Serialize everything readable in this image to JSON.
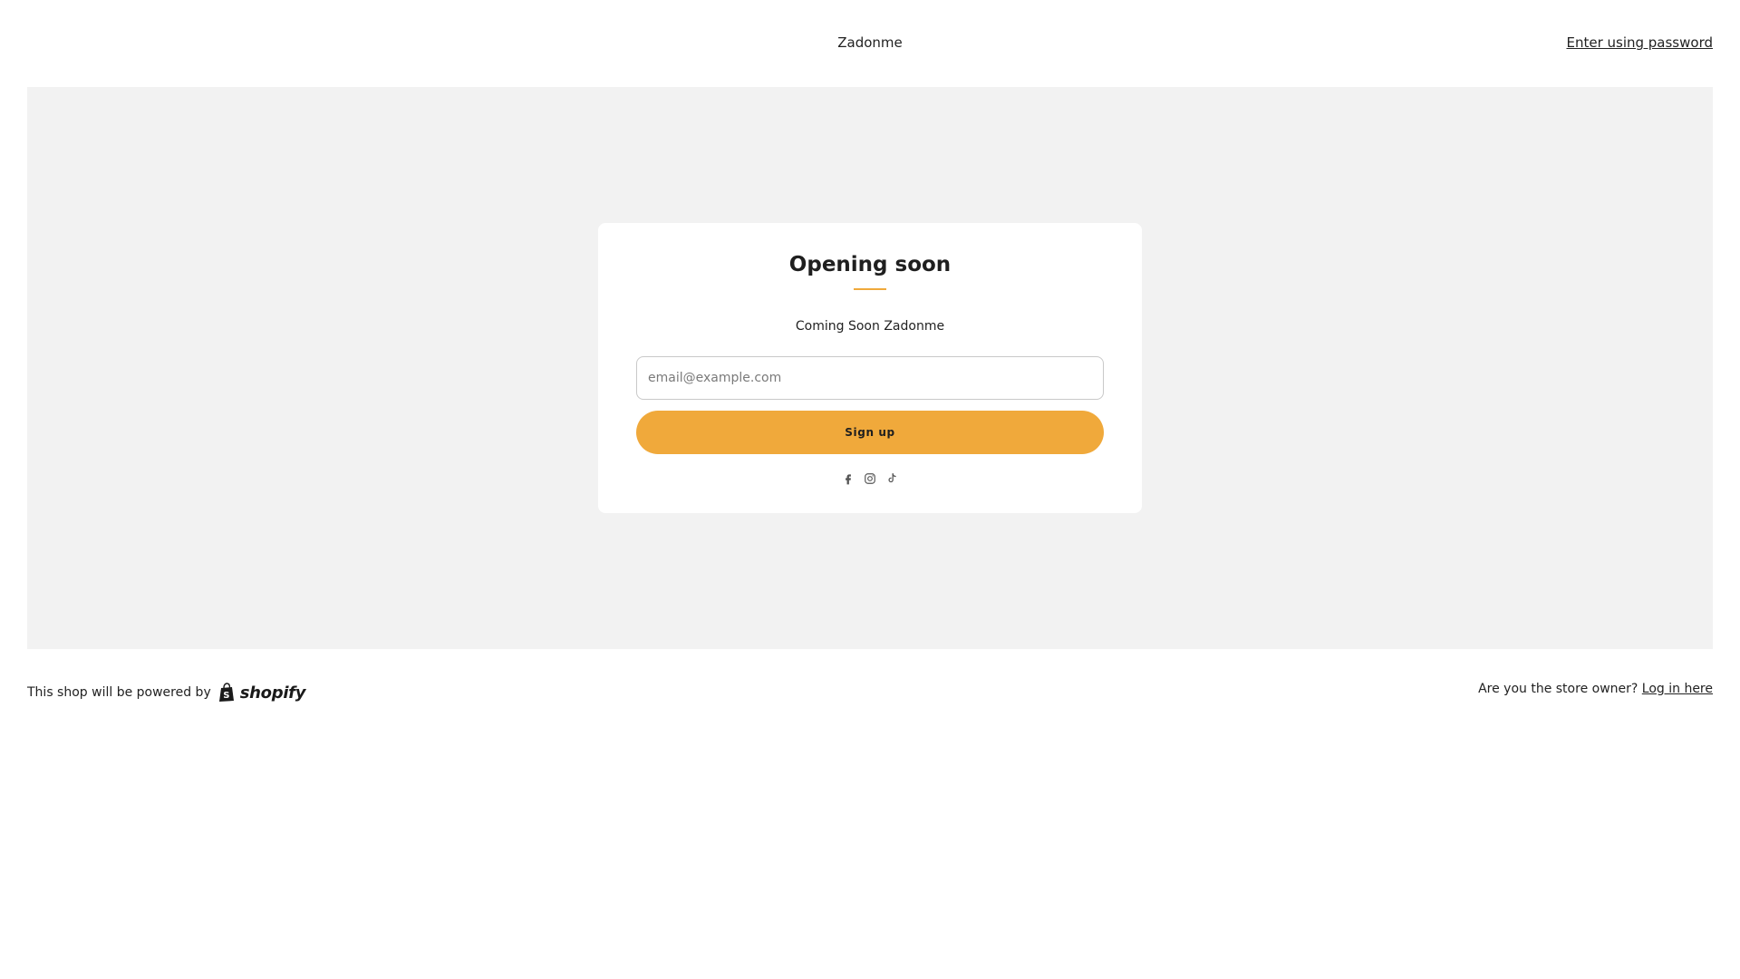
{
  "header": {
    "store_name": "Zadonme",
    "password_link": "Enter using password"
  },
  "card": {
    "title": "Opening soon",
    "subtitle": "Coming Soon Zadonme",
    "email_placeholder": "email@example.com",
    "signup_label": "Sign up",
    "social_icons": [
      "facebook-icon",
      "instagram-icon",
      "tiktok-icon"
    ]
  },
  "footer": {
    "powered_by": "This shop will be powered by",
    "shopify_wordmark": "shopify",
    "owner_question": "Are you the store owner?",
    "login_link": "Log in here"
  },
  "colors": {
    "accent": "#f0a93b",
    "hero_background": "#f2f2f2",
    "text": "#1f1f1f"
  }
}
